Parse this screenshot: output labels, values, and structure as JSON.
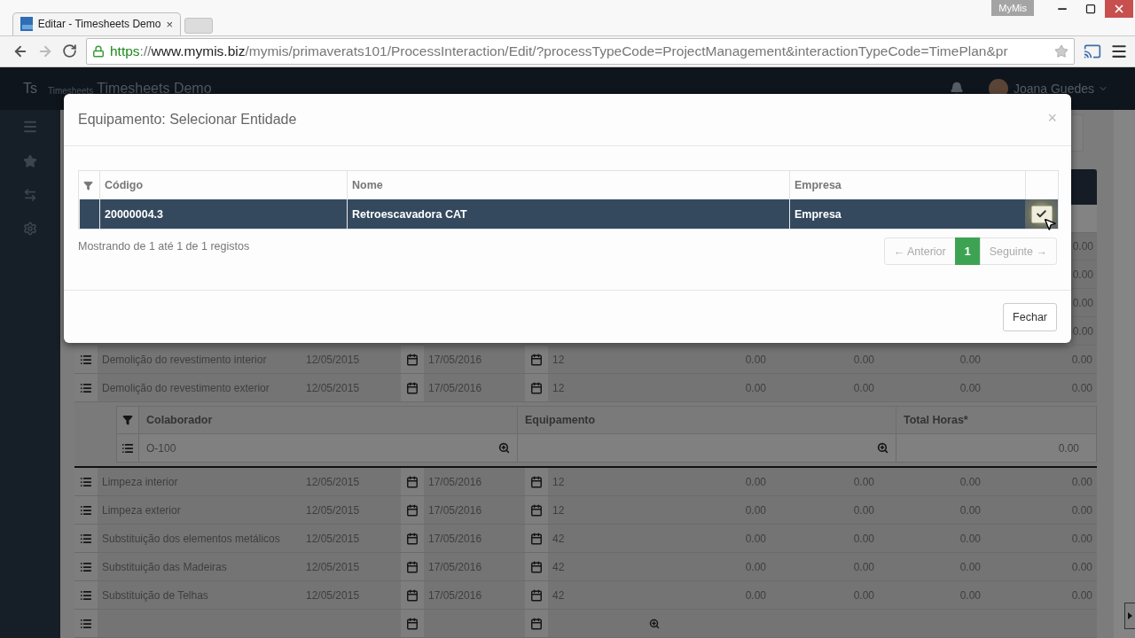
{
  "browser": {
    "tab_title": "Editar - Timesheets Demo",
    "tab_close": "×",
    "profile_badge": "MyMis",
    "url": [
      {
        "kind": "scheme",
        "text": "https"
      },
      {
        "kind": "plain",
        "text": "://"
      },
      {
        "kind": "host",
        "text": "www.mymis.biz"
      },
      {
        "kind": "plain",
        "text": "/mymis/primaverats101/ProcessInteraction/Edit/?processTypeCode=ProjectManagement&interactionTypeCode=TimePlan&pr"
      }
    ]
  },
  "app": {
    "logo": "Ts",
    "logo_caption": "Timesheets",
    "title": "Timesheets Demo",
    "user": "Joana Guedes"
  },
  "background": {
    "peek_values": [
      "0.00",
      "0.00",
      "0.00",
      "0.00"
    ],
    "rows_before": [
      {
        "name": "Demolição do revestimento interior",
        "start": "12/05/2015",
        "end": "17/05/2016",
        "duration": "12",
        "values": [
          "0.00",
          "0.00",
          "0.00",
          "0.00"
        ]
      },
      {
        "name": "Demolição do revestimento exterior",
        "start": "12/05/2015",
        "end": "17/05/2016",
        "duration": "12",
        "values": [
          "0.00",
          "0.00",
          "0.00",
          "0.00"
        ]
      }
    ],
    "subtable": {
      "columns": [
        "Colaborador",
        "Equipamento",
        "Total Horas*"
      ],
      "row": {
        "colaborador": "O-100",
        "total": "0.00"
      }
    },
    "rows_after": [
      {
        "name": "Limpeza interior",
        "start": "12/05/2015",
        "end": "17/05/2016",
        "duration": "12",
        "values": [
          "0.00",
          "0.00",
          "0.00",
          "0.00"
        ]
      },
      {
        "name": "Limpeza exterior",
        "start": "12/05/2015",
        "end": "17/05/2016",
        "duration": "12",
        "values": [
          "0.00",
          "0.00",
          "0.00",
          "0.00"
        ]
      },
      {
        "name": "Substituição dos elementos metálicos",
        "start": "12/05/2015",
        "end": "17/05/2016",
        "duration": "42",
        "values": [
          "0.00",
          "0.00",
          "0.00",
          "0.00"
        ]
      },
      {
        "name": "Substituição das Madeiras",
        "start": "12/05/2015",
        "end": "17/05/2016",
        "duration": "42",
        "values": [
          "0.00",
          "0.00",
          "0.00",
          "0.00"
        ]
      },
      {
        "name": "Substituição de Telhas",
        "start": "12/05/2015",
        "end": "17/05/2016",
        "duration": "42",
        "values": [
          "0.00",
          "0.00",
          "0.00",
          "0.00"
        ]
      }
    ]
  },
  "modal": {
    "title": "Equipamento: Selecionar Entidade",
    "close": "×",
    "columns": [
      "Código",
      "Nome",
      "Empresa"
    ],
    "rows": [
      {
        "cells": [
          "20000004.3",
          "Retroescavadora CAT",
          "Empresa"
        ],
        "selected": true
      }
    ],
    "info": "Mostrando de 1 até 1 de 1 registos",
    "pagination": [
      {
        "label": "← Anterior",
        "selected": false,
        "disabled": true
      },
      {
        "label": "1",
        "selected": true,
        "disabled": false
      },
      {
        "label": "Seguinte →",
        "selected": false,
        "disabled": true
      }
    ],
    "close_button": "Fechar"
  }
}
